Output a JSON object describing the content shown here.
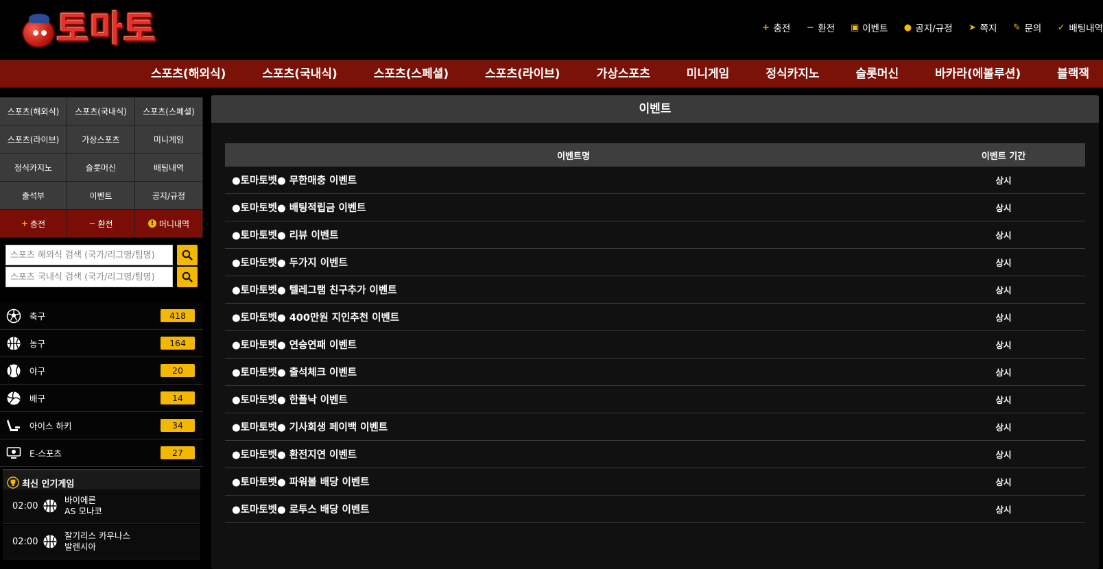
{
  "header": {
    "logo_text": "토마토",
    "top_links": [
      {
        "icon": "plus-icon",
        "label": "충전"
      },
      {
        "icon": "minus-icon",
        "label": "환전"
      },
      {
        "icon": "calendar-icon",
        "label": "이벤트"
      },
      {
        "icon": "alert-icon",
        "label": "공지/규정"
      },
      {
        "icon": "paper-plane-icon",
        "label": "쪽지"
      },
      {
        "icon": "edit-icon",
        "label": "문의"
      },
      {
        "icon": "check-icon",
        "label": "배팅내역"
      }
    ]
  },
  "nav": {
    "items": [
      "스포츠(해외식)",
      "스포츠(국내식)",
      "스포츠(스페셜)",
      "스포츠(라이브)",
      "가상스포츠",
      "미니게임",
      "정식카지노",
      "슬롯머신",
      "바카라(에볼루션)",
      "블랙잭"
    ]
  },
  "sidebar": {
    "grid": [
      "스포츠(해외식)",
      "스포츠(국내식)",
      "스포츠(스페셜)",
      "스포츠(라이브)",
      "가상스포츠",
      "미니게임",
      "정식카지노",
      "슬롯머신",
      "배팅내역",
      "출석부",
      "이벤트",
      "공지/규정"
    ],
    "actions": [
      {
        "icon": "plus-icon",
        "label": "충전"
      },
      {
        "icon": "minus-icon",
        "label": "환전"
      },
      {
        "icon": "alert-icon",
        "label": "머니내역"
      }
    ],
    "search_overseas_placeholder": "스포츠 해외식 검색 (국가/리그명/팀명)",
    "search_domestic_placeholder": "스포츠 국내식 검색 (국가/리그명/팀명)",
    "sports": [
      {
        "icon": "soccer-ball-icon",
        "name": "축구",
        "count": "418"
      },
      {
        "icon": "basketball-icon",
        "name": "농구",
        "count": "164"
      },
      {
        "icon": "baseball-icon",
        "name": "야구",
        "count": "20"
      },
      {
        "icon": "volleyball-icon",
        "name": "배구",
        "count": "14"
      },
      {
        "icon": "ice-hockey-icon",
        "name": "아이스 하키",
        "count": "34"
      },
      {
        "icon": "esports-icon",
        "name": "E-스포츠",
        "count": "27"
      }
    ],
    "popular_title": "최신 인기게임",
    "games": [
      {
        "time": "02:00",
        "home": "바이에른",
        "away": "AS 모나코"
      },
      {
        "time": "02:00",
        "home": "잘기리스 카우나스",
        "away": "발렌시아"
      }
    ]
  },
  "main": {
    "title": "이벤트",
    "col_name": "이벤트명",
    "col_period": "이벤트 기간",
    "events": [
      {
        "name": "●토마토벳● 무한매충 이벤트",
        "period": "상시"
      },
      {
        "name": "●토마토벳● 배팅적립금 이벤트",
        "period": "상시"
      },
      {
        "name": "●토마토벳● 리뷰 이벤트",
        "period": "상시"
      },
      {
        "name": "●토마토벳● 두가지 이벤트",
        "period": "상시"
      },
      {
        "name": "●토마토벳● 텔레그램 친구추가 이벤트",
        "period": "상시"
      },
      {
        "name": "●토마토벳● 400만원 지인추천 이벤트",
        "period": "상시"
      },
      {
        "name": "●토마토벳● 연승연패 이벤트",
        "period": "상시"
      },
      {
        "name": "●토마토벳● 출석체크 이벤트",
        "period": "상시"
      },
      {
        "name": "●토마토벳● 한폴낙 이벤트",
        "period": "상시"
      },
      {
        "name": "●토마토벳● 기사회생 페이백 이벤트",
        "period": "상시"
      },
      {
        "name": "●토마토벳● 환전지연 이벤트",
        "period": "상시"
      },
      {
        "name": "●토마토벳● 파워볼 배당 이벤트",
        "period": "상시"
      },
      {
        "name": "●토마토벳● 로투스 배당 이벤트",
        "period": "상시"
      }
    ]
  },
  "colors": {
    "accent": "#f5b800",
    "nav_red": "#7a1208",
    "panel": "#3b3b3b"
  }
}
